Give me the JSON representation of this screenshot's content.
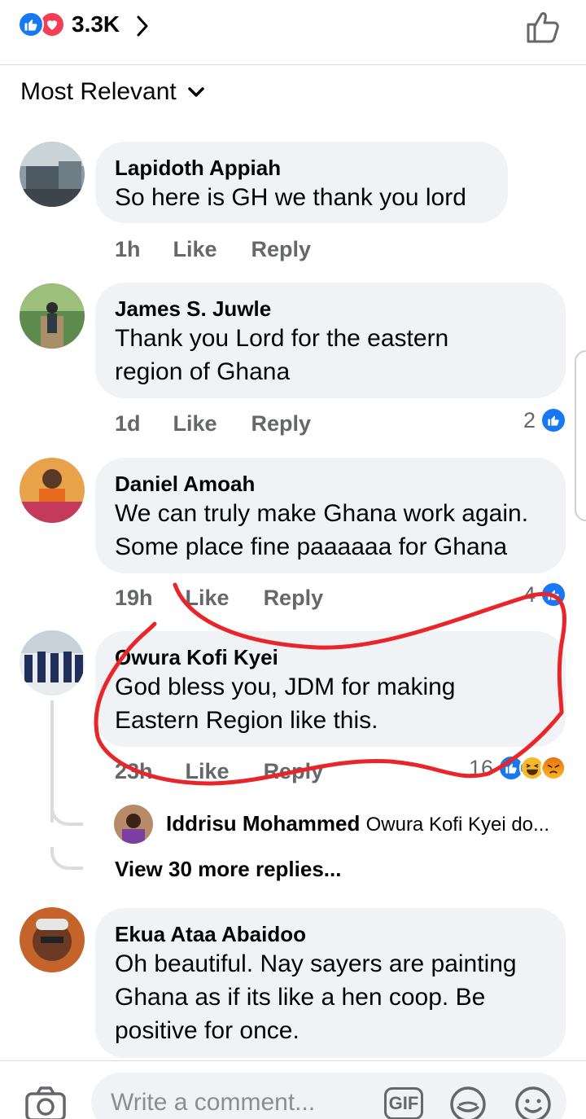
{
  "header": {
    "reaction_count": "3.3K",
    "reaction_icons": [
      "like-icon",
      "love-icon"
    ],
    "action_icon": "thumbs-up-outline-icon"
  },
  "sort": {
    "label": "Most Relevant"
  },
  "comments": [
    {
      "author": "Lapidoth Appiah",
      "lines": [
        "So here is GH we thank you lord"
      ],
      "time": "1h",
      "like": "Like",
      "reply": "Reply",
      "reactions": ""
    },
    {
      "author": "James S. Juwle",
      "lines": [
        "Thank you Lord for the eastern",
        "region of Ghana"
      ],
      "time": "1d",
      "like": "Like",
      "reply": "Reply",
      "reactions": "2"
    },
    {
      "author": "Daniel Amoah",
      "lines": [
        "We can truly make Ghana work again.",
        "Some place fine paaaaaa for Ghana"
      ],
      "time": "19h",
      "like": "Like",
      "reply": "Reply",
      "reactions": "4"
    },
    {
      "author": "Owura Kofi Kyei",
      "lines": [
        "God bless you, JDM for making",
        "Eastern Region like this."
      ],
      "time": "23h",
      "like": "Like",
      "reply": "Reply",
      "reactions": "16",
      "reply_preview": {
        "author": "Iddrisu Mohammed",
        "text": "Owura Kofi Kyei do..."
      },
      "view_more": "View 30 more replies..."
    },
    {
      "author": "Ekua Ataa Abaidoo",
      "lines": [
        "Oh beautiful. Nay sayers are painting",
        "Ghana as if its like a hen coop. Be",
        "positive for once."
      ]
    }
  ],
  "composer": {
    "placeholder": "Write a comment...",
    "gif_label": "GIF",
    "icons": [
      "camera-icon",
      "gif-icon",
      "sticker-icon",
      "emoji-icon"
    ]
  },
  "colors": {
    "facebook_blue": "#1877f2",
    "love_red": "#f33e58",
    "bubble_bg": "#f0f2f5",
    "meta_gray": "#65676b",
    "annotation_red": "#e8262a"
  }
}
